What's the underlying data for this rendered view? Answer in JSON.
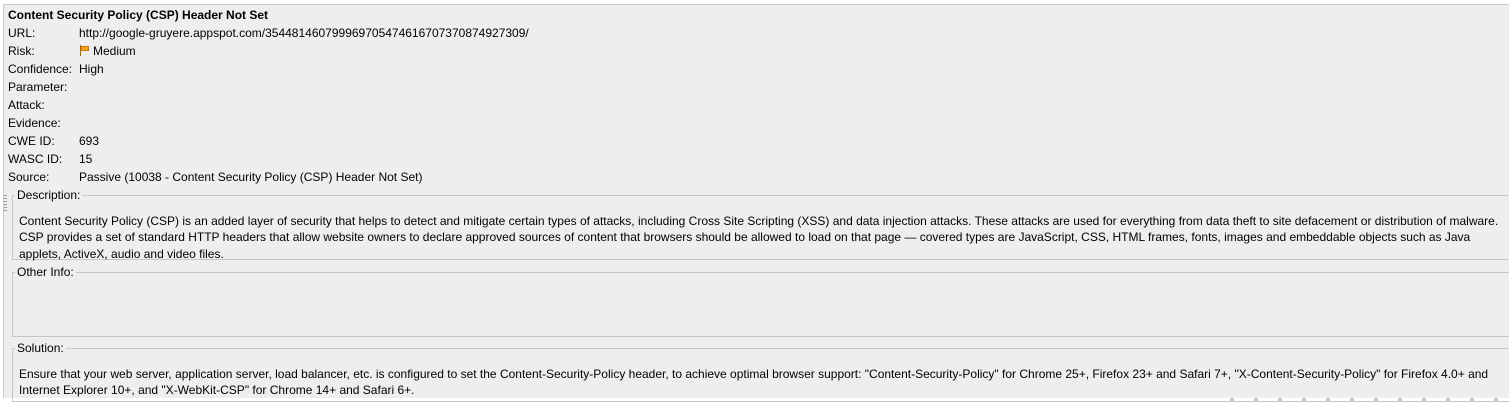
{
  "alert": {
    "title": "Content Security Policy (CSP) Header Not Set",
    "fields": {
      "url": {
        "label": "URL:",
        "value": "http://google-gruyere.appspot.com/354481460799969705474616707370874927309/"
      },
      "risk": {
        "label": "Risk:",
        "value": "Medium",
        "icon": "orange-flag-icon",
        "color": "#f5a623"
      },
      "confidence": {
        "label": "Confidence:",
        "value": "High"
      },
      "parameter": {
        "label": "Parameter:",
        "value": ""
      },
      "attack": {
        "label": "Attack:",
        "value": ""
      },
      "evidence": {
        "label": "Evidence:",
        "value": ""
      },
      "cwe": {
        "label": "CWE ID:",
        "value": "693"
      },
      "wasc": {
        "label": "WASC ID:",
        "value": "15"
      },
      "source": {
        "label": "Source:",
        "value": "Passive (10038 - Content Security Policy (CSP) Header Not Set)"
      }
    },
    "description": {
      "label": "Description:",
      "text": "Content Security Policy (CSP) is an added layer of security that helps to detect and mitigate certain types of attacks, including Cross Site Scripting (XSS) and data injection attacks. These attacks are used for everything from data theft to site defacement or distribution of malware. CSP provides a set of standard HTTP headers that allow website owners to declare approved sources of content that browsers should be allowed to load on that page — covered types are JavaScript, CSS, HTML frames, fonts, images and embeddable objects such as Java applets, ActiveX, audio and video files."
    },
    "other_info": {
      "label": "Other Info:",
      "text": ""
    },
    "solution": {
      "label": "Solution:",
      "text": "Ensure that your web server, application server, load balancer, etc. is configured to set the Content-Security-Policy header, to achieve optimal browser support: \"Content-Security-Policy\" for Chrome 25+, Firefox 23+ and Safari 7+, \"X-Content-Security-Policy\" for Firefox 4.0+ and Internet Explorer 10+, and \"X-WebKit-CSP\" for Chrome 14+ and Safari 6+."
    }
  }
}
